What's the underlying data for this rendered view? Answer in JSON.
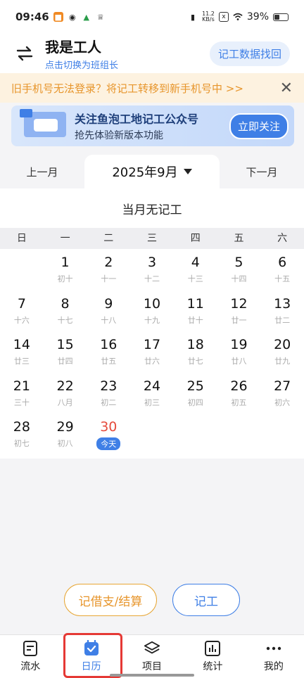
{
  "status_bar": {
    "time": "09:46",
    "net_speed_value": "11.2",
    "net_speed_unit": "KB/s",
    "battery": "39%"
  },
  "header": {
    "title": "我是工人",
    "subtitle": "点击切换为班组长",
    "find_button": "记工数据找回"
  },
  "notice": {
    "text": "旧手机号无法登录？将记工转移到新手机号中 >>"
  },
  "banner": {
    "title": "关注鱼泡工地记工公众号",
    "subtitle": "抢先体验新版本功能",
    "button": "立即关注"
  },
  "month_nav": {
    "prev": "上一月",
    "current": "2025年9月",
    "next": "下一月"
  },
  "summary": {
    "text": "当月无记工"
  },
  "weekdays": [
    "日",
    "一",
    "二",
    "三",
    "四",
    "五",
    "六"
  ],
  "calendar": {
    "rows": [
      [
        {
          "n": "",
          "l": ""
        },
        {
          "n": "1",
          "l": "初十"
        },
        {
          "n": "2",
          "l": "十一"
        },
        {
          "n": "3",
          "l": "十二"
        },
        {
          "n": "4",
          "l": "十三"
        },
        {
          "n": "5",
          "l": "十四"
        },
        {
          "n": "6",
          "l": "十五"
        }
      ],
      [
        {
          "n": "7",
          "l": "十六"
        },
        {
          "n": "8",
          "l": "十七"
        },
        {
          "n": "9",
          "l": "十八"
        },
        {
          "n": "10",
          "l": "十九"
        },
        {
          "n": "11",
          "l": "廿十"
        },
        {
          "n": "12",
          "l": "廿一"
        },
        {
          "n": "13",
          "l": "廿二"
        }
      ],
      [
        {
          "n": "14",
          "l": "廿三"
        },
        {
          "n": "15",
          "l": "廿四"
        },
        {
          "n": "16",
          "l": "廿五"
        },
        {
          "n": "17",
          "l": "廿六"
        },
        {
          "n": "18",
          "l": "廿七"
        },
        {
          "n": "19",
          "l": "廿八"
        },
        {
          "n": "20",
          "l": "廿九"
        }
      ],
      [
        {
          "n": "21",
          "l": "三十"
        },
        {
          "n": "22",
          "l": "八月"
        },
        {
          "n": "23",
          "l": "初二"
        },
        {
          "n": "24",
          "l": "初三"
        },
        {
          "n": "25",
          "l": "初四"
        },
        {
          "n": "26",
          "l": "初五"
        },
        {
          "n": "27",
          "l": "初六"
        }
      ],
      [
        {
          "n": "28",
          "l": "初七"
        },
        {
          "n": "29",
          "l": "初八"
        },
        {
          "n": "30",
          "l": "今天",
          "today": true
        },
        {
          "n": "",
          "l": ""
        },
        {
          "n": "",
          "l": ""
        },
        {
          "n": "",
          "l": ""
        },
        {
          "n": "",
          "l": ""
        }
      ]
    ]
  },
  "actions": {
    "loan_button": "记借支/结算",
    "record_button": "记工"
  },
  "tabs": [
    {
      "label": "流水",
      "icon": "document-icon"
    },
    {
      "label": "日历",
      "icon": "calendar-check-icon",
      "active": true
    },
    {
      "label": "项目",
      "icon": "layers-icon"
    },
    {
      "label": "统计",
      "icon": "bar-chart-icon"
    },
    {
      "label": "我的",
      "icon": "more-dots-icon"
    }
  ],
  "colors": {
    "accent": "#3f7fe6",
    "today": "#e54b3c",
    "notice": "#e7952b",
    "highlight": "#e53935"
  }
}
